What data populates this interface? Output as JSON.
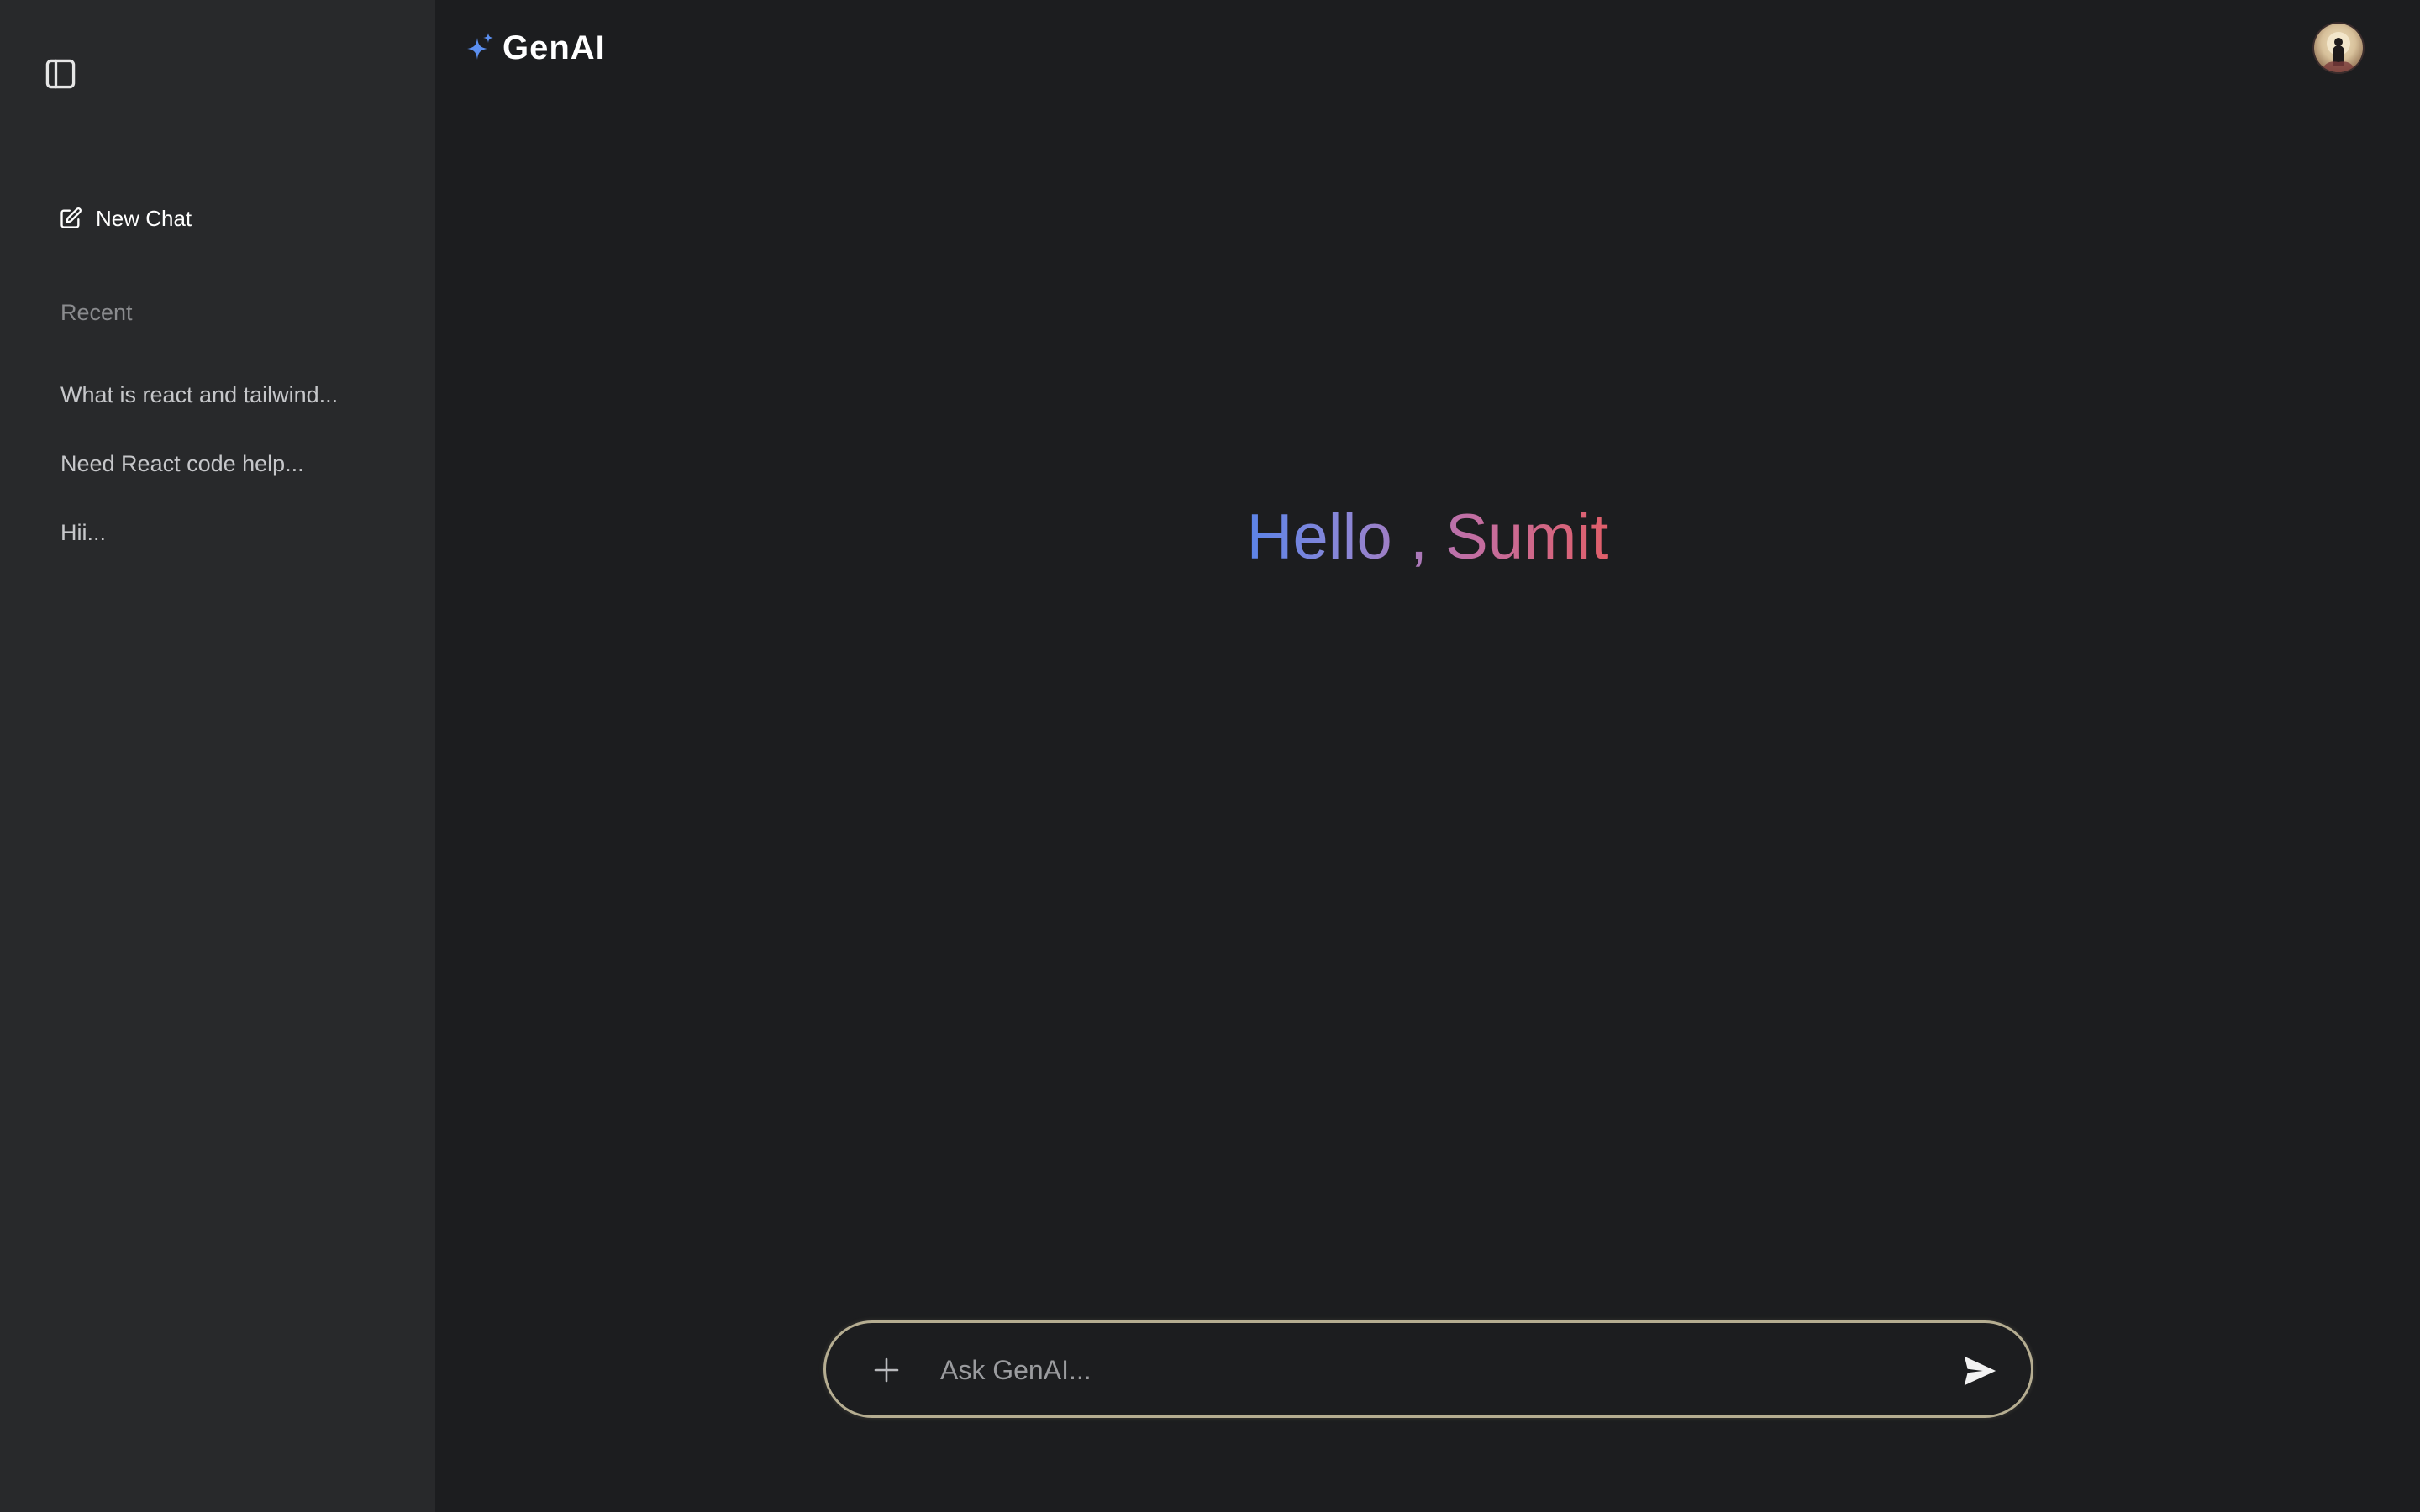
{
  "app": {
    "name": "GenAI"
  },
  "sidebar": {
    "new_chat_label": "New Chat",
    "recent_heading": "Recent",
    "recent_items": [
      {
        "label": "What is react and tailwind..."
      },
      {
        "label": "Need React code help..."
      },
      {
        "label": "Hii..."
      }
    ]
  },
  "main": {
    "greeting": "Hello , Sumit"
  },
  "prompt": {
    "placeholder": "Ask GenAI...",
    "value": ""
  },
  "icons": {
    "sidebar_toggle": "sidebar-panel-icon",
    "new_chat": "edit-icon",
    "brand": "sparkle-icon",
    "attach": "plus-icon",
    "send": "send-icon"
  },
  "colors": {
    "sidebar_bg": "#28292b",
    "main_bg": "#1c1d1f",
    "brand_sparkle": "#5b8ff0",
    "greeting_start": "#5b84e8",
    "greeting_end": "#e05f6a",
    "prompt_border": "#b5ad91"
  }
}
